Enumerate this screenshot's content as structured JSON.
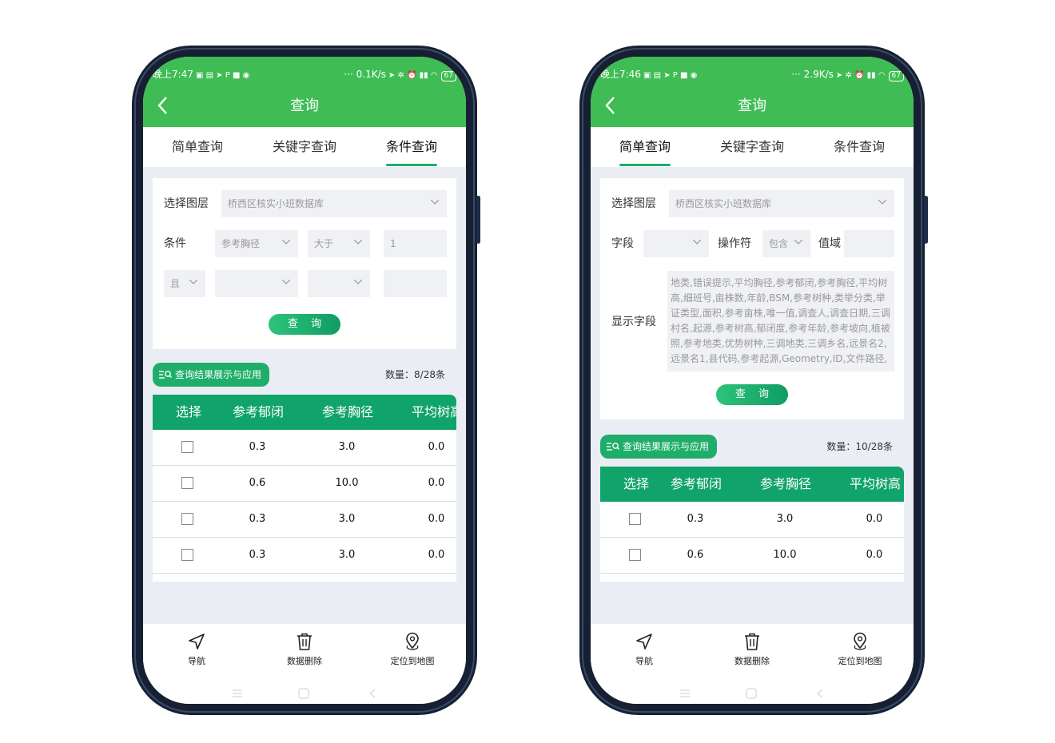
{
  "left": {
    "status": {
      "time": "晚上7:47",
      "speed": "0.1K/s",
      "battery": "67"
    },
    "title": "查询",
    "tabs": [
      "简单查询",
      "关键字查询",
      "条件查询"
    ],
    "active_tab": 2,
    "layer_label": "选择图层",
    "layer_value": "桥西区核实小班数据库",
    "condition_label": "条件",
    "cond_field": "参考胸径",
    "cond_op": "大于",
    "cond_value": "1",
    "logic": "且",
    "query_button": "查 询",
    "results_pill": "查询结果展示与应用",
    "count": "数量：8/28条",
    "headers": [
      "选择",
      "参考郁闭",
      "参考胸径",
      "平均树高"
    ],
    "rows": [
      [
        "0.3",
        "3.0",
        "0.0"
      ],
      [
        "0.6",
        "10.0",
        "0.0"
      ],
      [
        "0.3",
        "3.0",
        "0.0"
      ],
      [
        "0.3",
        "3.0",
        "0.0"
      ]
    ]
  },
  "right": {
    "status": {
      "time": "晚上7:46",
      "speed": "2.9K/s",
      "battery": "67"
    },
    "title": "查询",
    "tabs": [
      "简单查询",
      "关键字查询",
      "条件查询"
    ],
    "active_tab": 0,
    "layer_label": "选择图层",
    "layer_value": "桥西区核实小班数据库",
    "field_label": "字段",
    "op_label": "操作符",
    "op_value": "包含",
    "range_label": "值域",
    "display_label": "显示字段",
    "display_fields": "地类,错误提示,平均胸径,参考郁闭,参考胸径,平均树高,细班号,亩株数,年龄,BSM,参考树种,类举分类,举证类型,面积,参考亩株,唯一值,调查人,调查日期,三调村名,起源,参考树高,郁闭度,参考年龄,参考坡向,植被照,参考地类,优势树种,三调地类,三调乡名,远景名2,远景名1,县代码,参考起源,Geometry,ID,文件路径,",
    "query_button": "查 询",
    "results_pill": "查询结果展示与应用",
    "count": "数量：10/28条",
    "headers": [
      "选择",
      "参考郁闭",
      "参考胸径",
      "平均树高"
    ],
    "rows": [
      [
        "0.6",
        "10.0",
        "0.0"
      ]
    ],
    "first_row": [
      "0.3",
      "3.0",
      "0.0"
    ]
  },
  "bottom_bar": [
    "导航",
    "数据删除",
    "定位到地图"
  ],
  "icons": {
    "back": "chevron-left-icon",
    "navigate": "navigation-arrow-icon",
    "delete": "trash-icon",
    "locate": "map-pin-icon"
  },
  "colors": {
    "green": "#3fbd54",
    "accent": "#1fae6a",
    "table_header": "#10a36a"
  }
}
